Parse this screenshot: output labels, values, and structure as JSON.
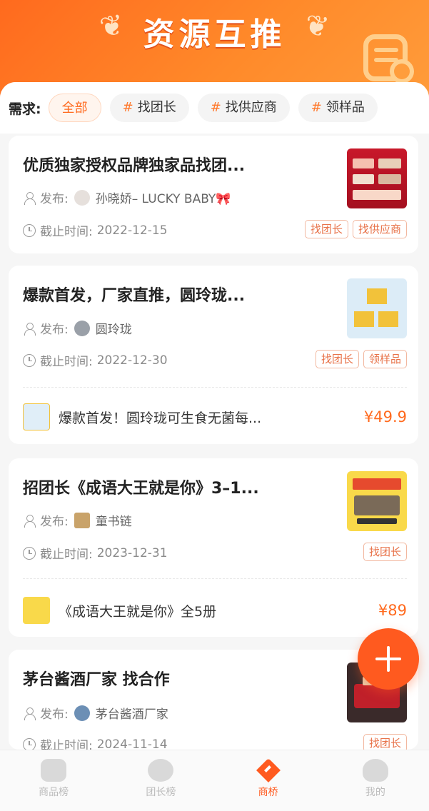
{
  "header": {
    "title": "资源互推"
  },
  "filter": {
    "label": "需求:",
    "chips": [
      "全部",
      "找团长",
      "找供应商",
      "领样品"
    ],
    "hash": "#"
  },
  "cards": [
    {
      "title": "优质独家授权品牌独家品找团...",
      "publisher_label": "发布:",
      "publisher_name": "孙晓娇– LUCKY BABY🎀",
      "deadline_label": "截止时间:",
      "deadline": "2022-12-15",
      "tags": [
        "找团长",
        "找供应商"
      ]
    },
    {
      "title": "爆款首发，厂家直推，圆玲珑...",
      "publisher_label": "发布:",
      "publisher_name": "圆玲珑",
      "deadline_label": "截止时间:",
      "deadline": "2022-12-30",
      "tags": [
        "找团长",
        "领样品"
      ],
      "product": {
        "name": "爆款首发！圆玲珑可生食无菌每...",
        "price": "¥49.9"
      }
    },
    {
      "title": "招团长《成语大王就是你》3–1...",
      "publisher_label": "发布:",
      "publisher_name": "童书链",
      "deadline_label": "截止时间:",
      "deadline": "2023-12-31",
      "tags": [
        "找团长"
      ],
      "product": {
        "name": "《成语大王就是你》全5册",
        "price": "¥89"
      }
    },
    {
      "title": "茅台酱酒厂家 找合作",
      "publisher_label": "发布:",
      "publisher_name": "茅台酱酒厂家",
      "deadline_label": "截止时间:",
      "deadline": "2024-11-14",
      "tags": [
        "找团长"
      ]
    }
  ],
  "tabbar": {
    "items": [
      "商品榜",
      "团长榜",
      "商桥",
      "我的"
    ],
    "active": "商桥"
  },
  "colors": {
    "accent": "#ff5a1f",
    "tag": "#e8734a"
  }
}
